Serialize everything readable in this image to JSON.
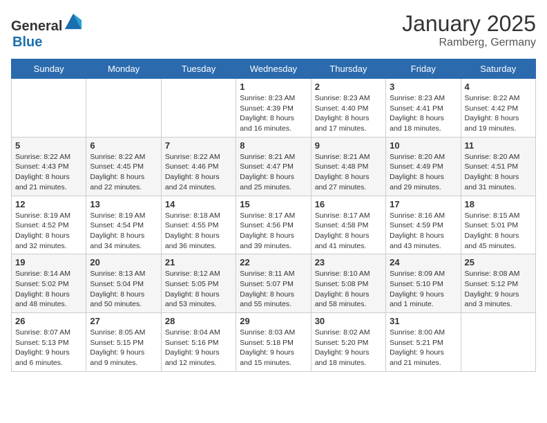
{
  "header": {
    "logo_general": "General",
    "logo_blue": "Blue",
    "month": "January 2025",
    "location": "Ramberg, Germany"
  },
  "days_of_week": [
    "Sunday",
    "Monday",
    "Tuesday",
    "Wednesday",
    "Thursday",
    "Friday",
    "Saturday"
  ],
  "weeks": [
    [
      {
        "day": "",
        "info": ""
      },
      {
        "day": "",
        "info": ""
      },
      {
        "day": "",
        "info": ""
      },
      {
        "day": "1",
        "sunrise": "Sunrise: 8:23 AM",
        "sunset": "Sunset: 4:39 PM",
        "daylight": "Daylight: 8 hours and 16 minutes."
      },
      {
        "day": "2",
        "sunrise": "Sunrise: 8:23 AM",
        "sunset": "Sunset: 4:40 PM",
        "daylight": "Daylight: 8 hours and 17 minutes."
      },
      {
        "day": "3",
        "sunrise": "Sunrise: 8:23 AM",
        "sunset": "Sunset: 4:41 PM",
        "daylight": "Daylight: 8 hours and 18 minutes."
      },
      {
        "day": "4",
        "sunrise": "Sunrise: 8:22 AM",
        "sunset": "Sunset: 4:42 PM",
        "daylight": "Daylight: 8 hours and 19 minutes."
      }
    ],
    [
      {
        "day": "5",
        "sunrise": "Sunrise: 8:22 AM",
        "sunset": "Sunset: 4:43 PM",
        "daylight": "Daylight: 8 hours and 21 minutes."
      },
      {
        "day": "6",
        "sunrise": "Sunrise: 8:22 AM",
        "sunset": "Sunset: 4:45 PM",
        "daylight": "Daylight: 8 hours and 22 minutes."
      },
      {
        "day": "7",
        "sunrise": "Sunrise: 8:22 AM",
        "sunset": "Sunset: 4:46 PM",
        "daylight": "Daylight: 8 hours and 24 minutes."
      },
      {
        "day": "8",
        "sunrise": "Sunrise: 8:21 AM",
        "sunset": "Sunset: 4:47 PM",
        "daylight": "Daylight: 8 hours and 25 minutes."
      },
      {
        "day": "9",
        "sunrise": "Sunrise: 8:21 AM",
        "sunset": "Sunset: 4:48 PM",
        "daylight": "Daylight: 8 hours and 27 minutes."
      },
      {
        "day": "10",
        "sunrise": "Sunrise: 8:20 AM",
        "sunset": "Sunset: 4:49 PM",
        "daylight": "Daylight: 8 hours and 29 minutes."
      },
      {
        "day": "11",
        "sunrise": "Sunrise: 8:20 AM",
        "sunset": "Sunset: 4:51 PM",
        "daylight": "Daylight: 8 hours and 31 minutes."
      }
    ],
    [
      {
        "day": "12",
        "sunrise": "Sunrise: 8:19 AM",
        "sunset": "Sunset: 4:52 PM",
        "daylight": "Daylight: 8 hours and 32 minutes."
      },
      {
        "day": "13",
        "sunrise": "Sunrise: 8:19 AM",
        "sunset": "Sunset: 4:54 PM",
        "daylight": "Daylight: 8 hours and 34 minutes."
      },
      {
        "day": "14",
        "sunrise": "Sunrise: 8:18 AM",
        "sunset": "Sunset: 4:55 PM",
        "daylight": "Daylight: 8 hours and 36 minutes."
      },
      {
        "day": "15",
        "sunrise": "Sunrise: 8:17 AM",
        "sunset": "Sunset: 4:56 PM",
        "daylight": "Daylight: 8 hours and 39 minutes."
      },
      {
        "day": "16",
        "sunrise": "Sunrise: 8:17 AM",
        "sunset": "Sunset: 4:58 PM",
        "daylight": "Daylight: 8 hours and 41 minutes."
      },
      {
        "day": "17",
        "sunrise": "Sunrise: 8:16 AM",
        "sunset": "Sunset: 4:59 PM",
        "daylight": "Daylight: 8 hours and 43 minutes."
      },
      {
        "day": "18",
        "sunrise": "Sunrise: 8:15 AM",
        "sunset": "Sunset: 5:01 PM",
        "daylight": "Daylight: 8 hours and 45 minutes."
      }
    ],
    [
      {
        "day": "19",
        "sunrise": "Sunrise: 8:14 AM",
        "sunset": "Sunset: 5:02 PM",
        "daylight": "Daylight: 8 hours and 48 minutes."
      },
      {
        "day": "20",
        "sunrise": "Sunrise: 8:13 AM",
        "sunset": "Sunset: 5:04 PM",
        "daylight": "Daylight: 8 hours and 50 minutes."
      },
      {
        "day": "21",
        "sunrise": "Sunrise: 8:12 AM",
        "sunset": "Sunset: 5:05 PM",
        "daylight": "Daylight: 8 hours and 53 minutes."
      },
      {
        "day": "22",
        "sunrise": "Sunrise: 8:11 AM",
        "sunset": "Sunset: 5:07 PM",
        "daylight": "Daylight: 8 hours and 55 minutes."
      },
      {
        "day": "23",
        "sunrise": "Sunrise: 8:10 AM",
        "sunset": "Sunset: 5:08 PM",
        "daylight": "Daylight: 8 hours and 58 minutes."
      },
      {
        "day": "24",
        "sunrise": "Sunrise: 8:09 AM",
        "sunset": "Sunset: 5:10 PM",
        "daylight": "Daylight: 9 hours and 1 minute."
      },
      {
        "day": "25",
        "sunrise": "Sunrise: 8:08 AM",
        "sunset": "Sunset: 5:12 PM",
        "daylight": "Daylight: 9 hours and 3 minutes."
      }
    ],
    [
      {
        "day": "26",
        "sunrise": "Sunrise: 8:07 AM",
        "sunset": "Sunset: 5:13 PM",
        "daylight": "Daylight: 9 hours and 6 minutes."
      },
      {
        "day": "27",
        "sunrise": "Sunrise: 8:05 AM",
        "sunset": "Sunset: 5:15 PM",
        "daylight": "Daylight: 9 hours and 9 minutes."
      },
      {
        "day": "28",
        "sunrise": "Sunrise: 8:04 AM",
        "sunset": "Sunset: 5:16 PM",
        "daylight": "Daylight: 9 hours and 12 minutes."
      },
      {
        "day": "29",
        "sunrise": "Sunrise: 8:03 AM",
        "sunset": "Sunset: 5:18 PM",
        "daylight": "Daylight: 9 hours and 15 minutes."
      },
      {
        "day": "30",
        "sunrise": "Sunrise: 8:02 AM",
        "sunset": "Sunset: 5:20 PM",
        "daylight": "Daylight: 9 hours and 18 minutes."
      },
      {
        "day": "31",
        "sunrise": "Sunrise: 8:00 AM",
        "sunset": "Sunset: 5:21 PM",
        "daylight": "Daylight: 9 hours and 21 minutes."
      },
      {
        "day": "",
        "info": ""
      }
    ]
  ]
}
